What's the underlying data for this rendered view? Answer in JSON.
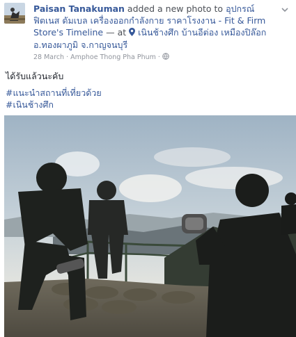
{
  "post": {
    "author": "Paisan Tanakuman",
    "action": "added a new photo to",
    "page_link": "อุปกรณ์ฟิตเนส ดัมเบล เครื่องออกกำลังกาย ราคาโรงงาน - Fit & Firm Store's Timeline",
    "at": "— at",
    "location": "เนินช้างศึก บ้านอีต่อง เหมืองปิล๊อก อ.ทองผาภูมิ จ.กาญจนบุรี",
    "date": "28 March",
    "place": "Amphoe Thong Pha Phum",
    "dot": "·",
    "text": "ได้รับแล้วนะคับ",
    "hashtags": [
      "#แนะนำสถานที่เที่ยวด้วย",
      "#เนินช้างศึก"
    ]
  },
  "icons": {
    "chevron": "chevron-down-icon",
    "pin": "map-pin-icon",
    "globe": "globe-icon"
  },
  "colors": {
    "link": "#365899",
    "meta": "#90949c",
    "text": "#1d2129"
  }
}
